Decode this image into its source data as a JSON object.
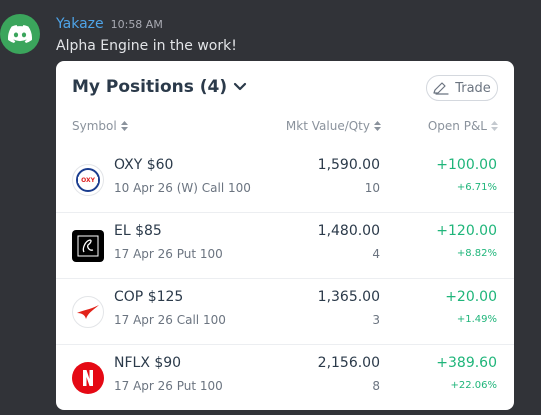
{
  "message": {
    "username": "Yakaze",
    "timestamp": "10:58 AM",
    "text": "Alpha Engine in the work!",
    "avatar_icon": "discord-logo-icon"
  },
  "card": {
    "title": "My Positions (4)",
    "trade_label": "Trade",
    "columns": {
      "symbol": "Symbol",
      "market_value": "Mkt Value/Qty",
      "open_pl": "Open P&L"
    },
    "positions": [
      {
        "symbol": "OXY $60",
        "description": "10 Apr 26 (W) Call 100",
        "market_value": "1,590.00",
        "qty": "10",
        "pl": "+100.00",
        "pl_pct": "+6.71%",
        "logo": "oxy-logo-icon"
      },
      {
        "symbol": "EL $85",
        "description": "17 Apr 26 Put 100",
        "market_value": "1,480.00",
        "qty": "4",
        "pl": "+120.00",
        "pl_pct": "+8.82%",
        "logo": "el-logo-icon"
      },
      {
        "symbol": "COP $125",
        "description": "17 Apr 26 Call 100",
        "market_value": "1,365.00",
        "qty": "3",
        "pl": "+20.00",
        "pl_pct": "+1.49%",
        "logo": "cop-logo-icon"
      },
      {
        "symbol": "NFLX $90",
        "description": "17 Apr 26 Put 100",
        "market_value": "2,156.00",
        "qty": "8",
        "pl": "+389.60",
        "pl_pct": "+22.06%",
        "logo": "nflx-logo-icon"
      }
    ]
  },
  "colors": {
    "background": "#313338",
    "username": "#4ea4e8",
    "gain": "#1fb57a",
    "avatar": "#3ba55c"
  }
}
